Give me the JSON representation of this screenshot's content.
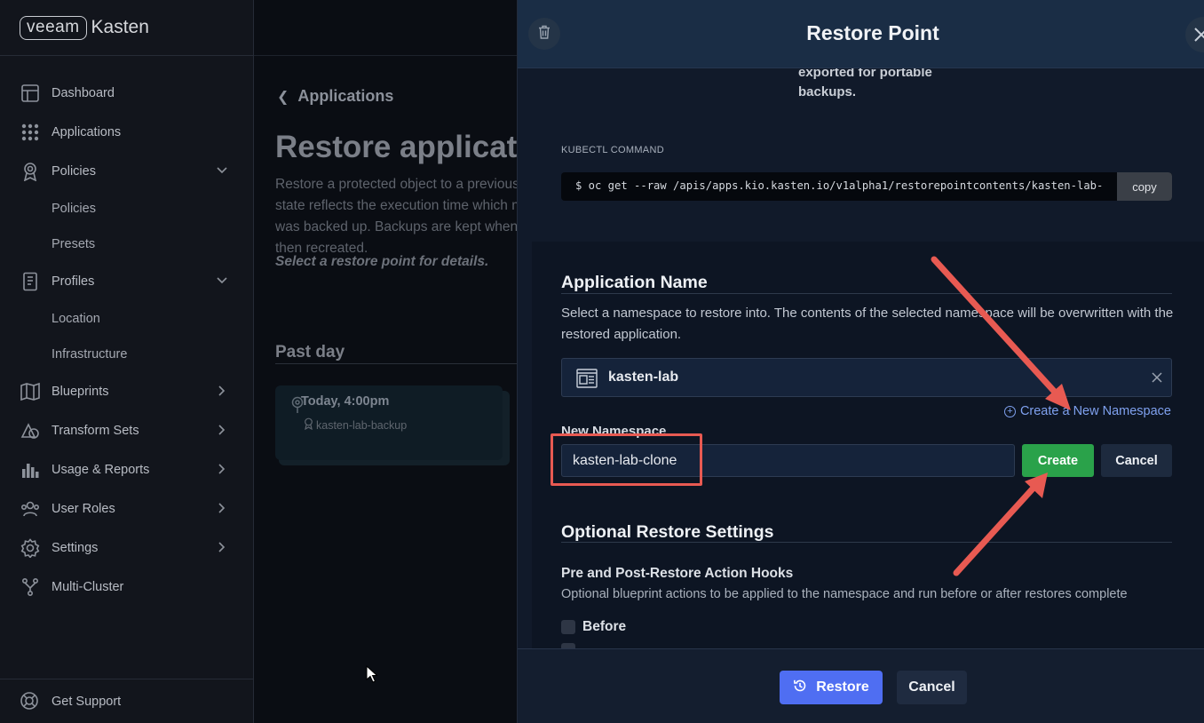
{
  "brand": {
    "veeam": "veeam",
    "kasten": "Kasten"
  },
  "sidebar": {
    "items": [
      {
        "label": "Dashboard",
        "icon": "dashboard-icon"
      },
      {
        "label": "Applications",
        "icon": "applications-icon"
      },
      {
        "label": "Policies",
        "icon": "policies-icon",
        "expanded": true
      },
      {
        "label": "Policies",
        "sub": true
      },
      {
        "label": "Presets",
        "sub": true
      },
      {
        "label": "Profiles",
        "icon": "profiles-icon",
        "expanded": true
      },
      {
        "label": "Location",
        "sub": true
      },
      {
        "label": "Infrastructure",
        "sub": true
      },
      {
        "label": "Blueprints",
        "icon": "blueprints-icon"
      },
      {
        "label": "Transform Sets",
        "icon": "transform-sets-icon"
      },
      {
        "label": "Usage & Reports",
        "icon": "usage-reports-icon"
      },
      {
        "label": "User Roles",
        "icon": "user-roles-icon"
      },
      {
        "label": "Settings",
        "icon": "settings-icon"
      },
      {
        "label": "Multi-Cluster",
        "icon": "multi-cluster-icon"
      }
    ],
    "support": "Get Support"
  },
  "main": {
    "back": "Applications",
    "title": "Restore application",
    "description": "Restore a protected object to a previous state. The restored application state reflects the execution time which may be different from the time it was backed up. Backups are kept when the application is deleted and then recreated.",
    "select_hint": "Select a restore point for details.",
    "past_day": "Past day",
    "restore_point": {
      "time": "Today, 4:00pm",
      "name": "kasten-lab-backup"
    }
  },
  "panel": {
    "title": "Restore Point",
    "exported_text_1": "exported for portable",
    "exported_text_2": "backups.",
    "kubectl_label": "KUBECTL COMMAND",
    "kubectl_command": "$ oc get --raw /apis/apps.kio.kasten.io/v1alpha1/restorepointcontents/kasten-lab-",
    "copy_label": "copy",
    "app_name_title": "Application Name",
    "app_name_desc": "Select a namespace to restore into. The contents of the selected namespace will be overwritten with the restored application.",
    "selected_namespace": "kasten-lab",
    "create_namespace_link": "Create a New Namespace",
    "new_namespace_label": "New Namespace",
    "new_namespace_value": "kasten-lab-clone",
    "create_label": "Create",
    "cancel_small_label": "Cancel",
    "optional_title": "Optional Restore Settings",
    "hooks_title": "Pre and Post-Restore Action Hooks",
    "hooks_desc": "Optional blueprint actions to be applied to the namespace and run before or after restores complete",
    "before_label": "Before",
    "restore_label": "Restore",
    "cancel_label": "Cancel"
  },
  "colors": {
    "accent": "#4f6ef2",
    "create": "#2aa24a",
    "annotation": "#e85a52",
    "link": "#7fa1ef"
  }
}
